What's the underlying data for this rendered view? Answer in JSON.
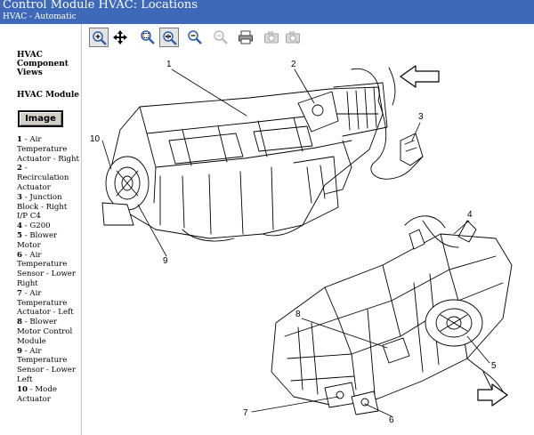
{
  "header": {
    "title": "Control Module HVAC:  Locations",
    "subtitle": "HVAC - Automatic"
  },
  "sidebar": {
    "component_views": "HVAC Component Views",
    "module": "HVAC Module",
    "image_button": "Image",
    "legend": [
      {
        "num": "1",
        "label": "Air Temperature Actuator - Right"
      },
      {
        "num": "2",
        "label": "Recirculation Actuator"
      },
      {
        "num": "3",
        "label": "Junction Block - Right I/P C4"
      },
      {
        "num": "4",
        "label": "G200"
      },
      {
        "num": "5",
        "label": "Blower Motor"
      },
      {
        "num": "6",
        "label": "Air Temperature Sensor - Lower Right"
      },
      {
        "num": "7",
        "label": "Air Temperature Actuator - Left"
      },
      {
        "num": "8",
        "label": "Blower Motor Control Module"
      },
      {
        "num": "9",
        "label": "Air Temperature Sensor - Lower Left"
      },
      {
        "num": "10",
        "label": "Mode Actuator"
      }
    ]
  },
  "toolbar": [
    {
      "name": "zoom-in-tool",
      "icon": "zoom-in-icon",
      "active": true
    },
    {
      "name": "pan-tool",
      "icon": "pan-arrows-icon",
      "active": false
    },
    {
      "name": "zoom-region-tool",
      "icon": "zoom-region-icon",
      "active": false
    },
    {
      "name": "fit-to-window-tool",
      "icon": "zoom-fit-icon",
      "active": true
    },
    {
      "name": "zoom-out-tool",
      "icon": "zoom-out-icon",
      "active": false
    },
    {
      "name": "zoom-out-disabled-tool",
      "icon": "zoom-out-disabled-icon",
      "active": false
    },
    {
      "name": "print-tool",
      "icon": "printer-icon",
      "active": false
    },
    {
      "name": "copy-image-tool",
      "icon": "camera-icon",
      "active": false
    },
    {
      "name": "save-image-tool",
      "icon": "camera-save-icon",
      "active": false
    }
  ],
  "callouts": [
    "1",
    "2",
    "3",
    "4",
    "5",
    "6",
    "7",
    "8",
    "9",
    "10"
  ],
  "colors": {
    "header_bg": "#3e68b8",
    "header_text": "#ffffff",
    "icon_blue": "#2a5db0"
  }
}
